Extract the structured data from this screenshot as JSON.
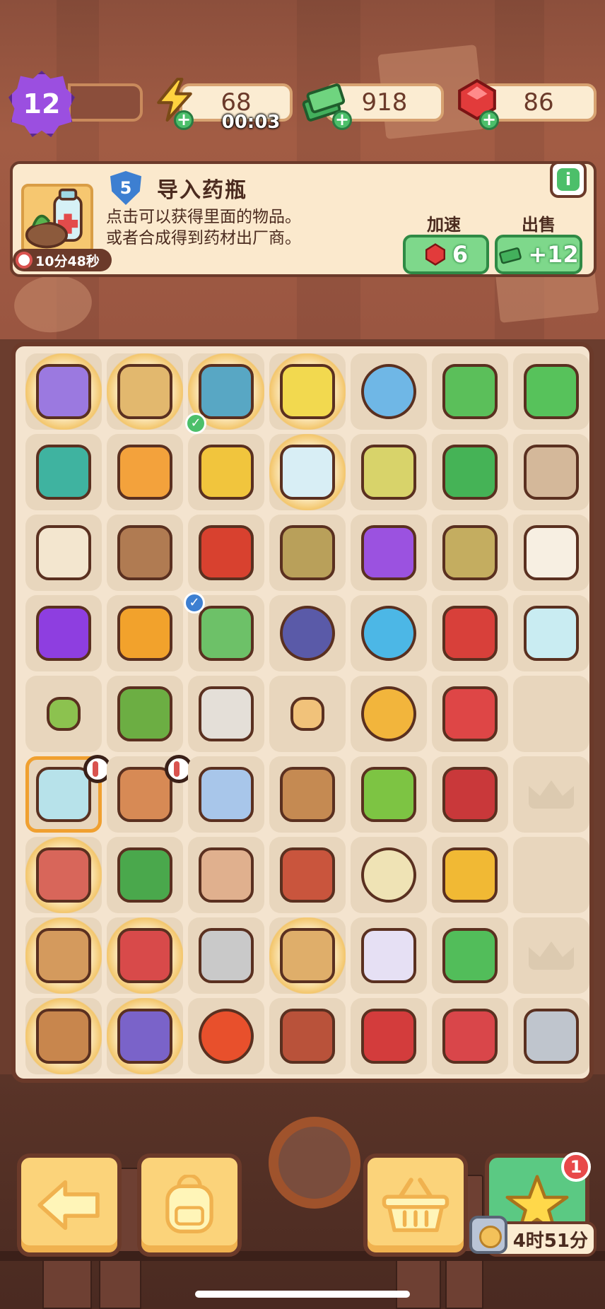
{
  "hud": {
    "level": "12",
    "energy": "68",
    "energy_timer": "00:03",
    "cash": "918",
    "gems": "86"
  },
  "info": {
    "item_level": "5",
    "title": "导入药瓶",
    "desc_line1": "点击可以获得里面的物品。",
    "desc_line2": "或者合成得到药材出厂商。",
    "timer": "10分48秒",
    "speed_label": "加速",
    "speed_cost": "6",
    "sell_label": "出售",
    "sell_value": "+12",
    "info_icon": "i"
  },
  "bottom": {
    "shop_badge": "1",
    "shop_timer": "4时51分"
  },
  "board_items": [
    [
      "purple-car",
      "map-table",
      "workbench",
      "yellow-machine",
      "magnifier",
      "leaf-sprout",
      "cash-stack"
    ],
    [
      "medkit",
      "oil-bottle",
      "cup-jar",
      "glass-bottle-box",
      "seed-sack",
      "cash-bundle",
      "photo-packet"
    ],
    [
      "wood-blocks",
      "clay-pot",
      "ladybug",
      "cloth-bag",
      "purple-star-smile",
      "cloth-bag-small",
      "tile"
    ],
    [
      "purple-star",
      "juice-box",
      "green-broom",
      "wheels",
      "lightning-orb",
      "red-toolbox",
      "medicine-jar"
    ],
    [
      "sprout",
      "potted-plant",
      "stool",
      "amber-tile",
      "goggles",
      "red-box",
      "empty"
    ],
    [
      "medicine-kit",
      "vase",
      "trophy",
      "crate-stack",
      "green-shoe",
      "pruners",
      "empty-slot"
    ],
    [
      "toy-engine",
      "cabbage",
      "flask",
      "retro-tv",
      "lamp-globe",
      "hook",
      "empty"
    ],
    [
      "crate-vase",
      "red-toolbox-open",
      "sink-cabinet",
      "open-box",
      "lamp-pair",
      "cash-pile",
      "empty-slot"
    ],
    [
      "bonsai-pot",
      "gift-tools",
      "energy-orb",
      "pouch",
      "red-case",
      "gloves",
      "trowel"
    ]
  ]
}
